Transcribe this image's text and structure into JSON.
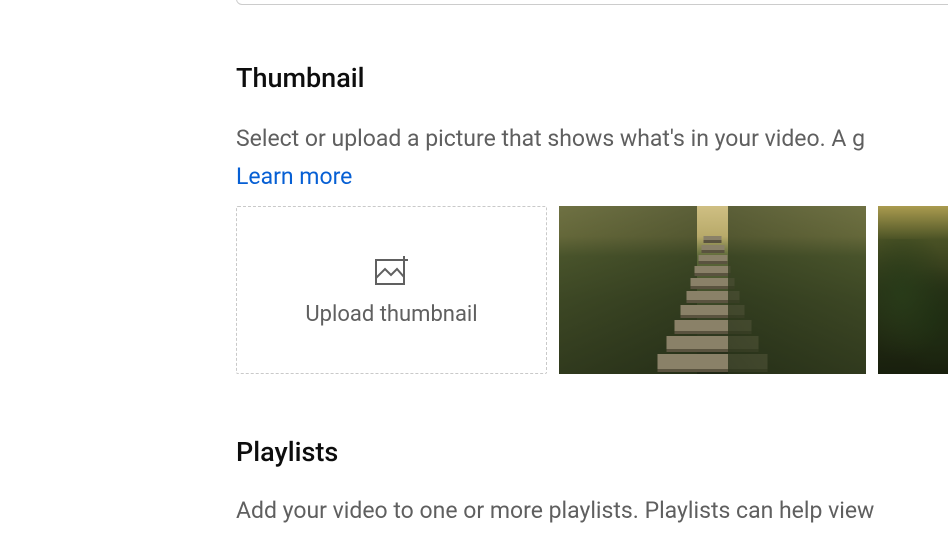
{
  "thumbnail": {
    "title": "Thumbnail",
    "description": "Select or upload a picture that shows what's in your video. A g",
    "learn_more": "Learn more",
    "upload_label": "Upload thumbnail"
  },
  "playlists": {
    "title": "Playlists",
    "description": "Add your video to one or more playlists. Playlists can help view"
  }
}
